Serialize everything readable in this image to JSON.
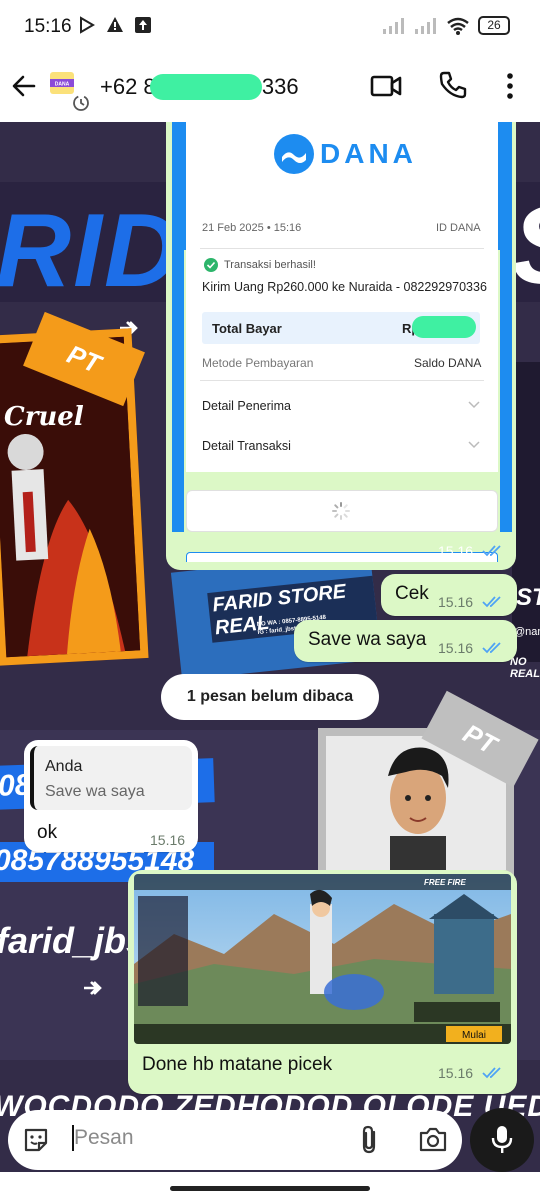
{
  "status": {
    "time": "15:16",
    "battery": "26"
  },
  "header": {
    "contact_prefix": "+62 82",
    "contact_suffix": "336",
    "avatar_text": "DANA"
  },
  "colors": {
    "bubble_out": "#dcf8c6",
    "bubble_in": "#ffffff",
    "chat_bg": "#332c48",
    "dana_blue": "#1d8cf0",
    "redaction": "#3ff0a2",
    "tick_blue": "#4fa3f5"
  },
  "wallpaper": {
    "big_text_left": "RID ST",
    "big_text_right": "S",
    "orange_tag": "PT",
    "cruel_text": "Cruel",
    "store_name": "FARID STORE REAL",
    "store_phone": "NO WA : 0857-8895-5148",
    "store_ig": "IG : farid_jbstore",
    "right_handle": "@nan",
    "right_noreal": "NO REAL",
    "right_st": "ST",
    "phone_fragment_1": "08",
    "phone_fragment_2": "085788955148",
    "handle": "farid_jbs",
    "gray_tag": "PT",
    "bottom_text": "WOCDODO ZEDHODOD OLODE UEDO"
  },
  "receipt": {
    "brand": "DANA",
    "date": "21 Feb 2025 • 15:16",
    "id_label": "ID DANA",
    "status": "Transaksi berhasil!",
    "description": "Kirim Uang Rp260.000 ke Nuraida - 082292970336",
    "total_label": "Total Bayar",
    "total_value": "Rp",
    "method_label": "Metode Pembayaran",
    "method_value": "Saldo DANA",
    "recipient_detail": "Detail Penerima",
    "transaction_detail": "Detail Transaksi",
    "time": "15.16"
  },
  "messages": [
    {
      "text": "Cek",
      "time": "15.16"
    },
    {
      "text": "Save wa saya",
      "time": "15.16"
    }
  ],
  "unread": "1 pesan belum dibaca",
  "reply": {
    "quote_author": "Anda",
    "quote_text": "Save wa saya",
    "text": "ok",
    "time": "15.16"
  },
  "image_message": {
    "caption": "Done hb matane picek",
    "time": "15.16",
    "game_button": "Mulai",
    "game_name": "FREE FIRE"
  },
  "input": {
    "placeholder": "Pesan"
  }
}
